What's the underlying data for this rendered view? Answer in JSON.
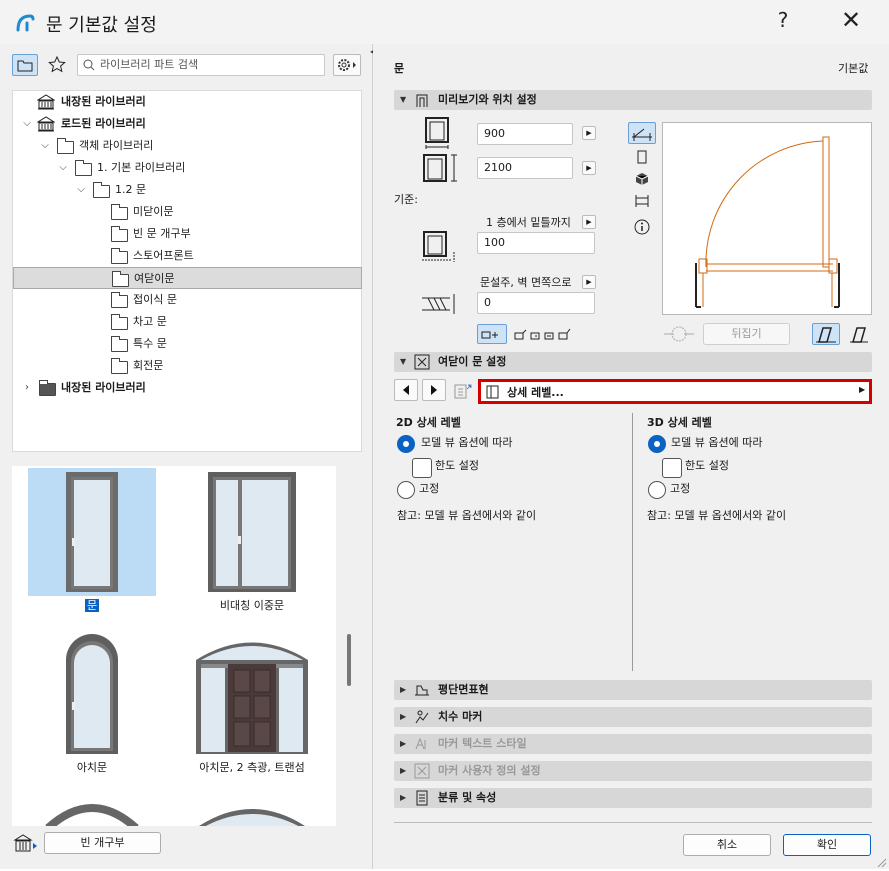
{
  "window": {
    "title": "문 기본값 설정",
    "help_label": "?",
    "close_label": "✕"
  },
  "left": {
    "search_placeholder": "라이브러리 파트 검색",
    "tree": [
      {
        "label": "내장된 라이브러리",
        "bold": true,
        "icon": "library-icon",
        "expand": "none",
        "indent": 0
      },
      {
        "label": "로드된 라이브러리",
        "bold": true,
        "icon": "library-icon",
        "expand": "open",
        "indent": 0
      },
      {
        "label": "객체 라이브러리",
        "icon": "folder-icon",
        "expand": "open",
        "indent": 1
      },
      {
        "label": "1. 기본 라이브러리",
        "icon": "folder-icon",
        "expand": "open",
        "indent": 2
      },
      {
        "label": "1.2 문",
        "icon": "folder-icon",
        "expand": "open",
        "indent": 3
      },
      {
        "label": "미닫이문",
        "icon": "folder-icon",
        "expand": "none",
        "indent": 4
      },
      {
        "label": "빈 문 개구부",
        "icon": "folder-icon",
        "expand": "none",
        "indent": 4
      },
      {
        "label": "스토어프론트",
        "icon": "folder-icon",
        "expand": "none",
        "indent": 4
      },
      {
        "label": "여닫이문",
        "icon": "folder-icon",
        "expand": "none",
        "indent": 4,
        "selected": true
      },
      {
        "label": "접이식 문",
        "icon": "folder-icon",
        "expand": "none",
        "indent": 4
      },
      {
        "label": "차고 문",
        "icon": "folder-icon",
        "expand": "none",
        "indent": 4
      },
      {
        "label": "특수 문",
        "icon": "folder-icon",
        "expand": "none",
        "indent": 4
      },
      {
        "label": "회전문",
        "icon": "folder-icon",
        "expand": "none",
        "indent": 4
      },
      {
        "label": "내장된 라이브러리",
        "bold": true,
        "icon": "folder-dark-icon",
        "expand": "closed",
        "indent": 0
      }
    ],
    "thumbnails": [
      {
        "caption": "문",
        "selected": true
      },
      {
        "caption": "비대칭 이중문"
      },
      {
        "caption": "아치문"
      },
      {
        "caption": "아치문, 2 측광, 트랜섬"
      }
    ],
    "empty_opening_button": "빈 개구부"
  },
  "right": {
    "header": {
      "title": "문",
      "defaults_label": "기본값"
    },
    "preview_section": {
      "title": "미리보기와 위치 설정",
      "width": "900",
      "height": "2100",
      "reference_label": "기준:",
      "elevation_mode": "1 층에서 밑틀까지",
      "elevation_value": "100",
      "reveal_mode": "문설주, 벽 면쪽으로",
      "reveal_value": "0",
      "flip_button": "뒤집기"
    },
    "door_settings": {
      "title": "여닫이 문 설정",
      "page_selector": "상세 레벨...",
      "col2d": {
        "title": "2D 상세 레벨",
        "opt_model": "모델 뷰 옵션에 따라",
        "opt_limit": "한도 설정",
        "opt_fixed": "고정",
        "note": "참고: 모델 뷰 옵션에서와 같이"
      },
      "col3d": {
        "title": "3D 상세 레벨",
        "opt_model": "모델 뷰 옵션에 따라",
        "opt_limit": "한도 설정",
        "opt_fixed": "고정",
        "note": "참고: 모델 뷰 옵션에서와 같이"
      }
    },
    "sections": [
      {
        "label": "평단면표현",
        "enabled": true
      },
      {
        "label": "치수 마커",
        "enabled": true
      },
      {
        "label": "마커 텍스트 스타일",
        "enabled": false
      },
      {
        "label": "마커 사용자 정의 설정",
        "enabled": false
      },
      {
        "label": "분류 및 속성",
        "enabled": true
      }
    ],
    "cancel_button": "취소",
    "ok_button": "확인"
  },
  "colors": {
    "accent": "#0a62c2",
    "highlight_border": "#d40000",
    "door_line": "#d06a10",
    "selection_bg": "#bcdcf5"
  }
}
